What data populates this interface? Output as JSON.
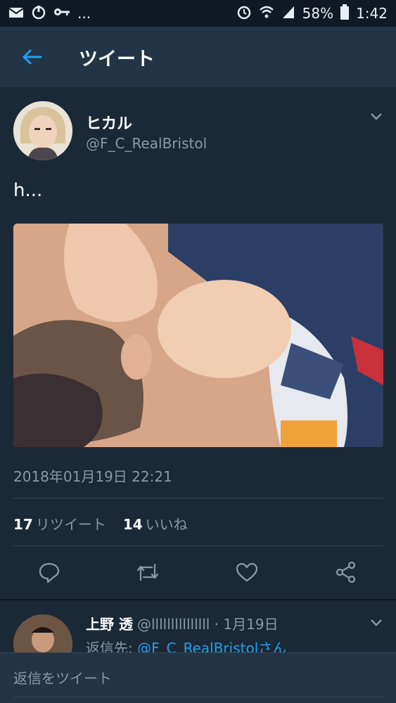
{
  "status_bar": {
    "left_more": "...",
    "battery": "58%",
    "time": "1:42"
  },
  "header": {
    "title": "ツイート"
  },
  "tweet": {
    "name": "ヒカル",
    "handle": "@F_C_RealBristol",
    "text": "h...",
    "timestamp": "2018年01月19日 22:21",
    "retweet_count": "17",
    "retweet_label": "リツイート",
    "like_count": "14",
    "like_label": "いいね"
  },
  "reply": {
    "name": "上野 透",
    "meta": "@lllllllllllllll · 1月19日",
    "reply_to_prefix": "返信先:",
    "reply_to_handle": "@F_C_RealBristolさん"
  },
  "compose": {
    "placeholder": "返信をツイート"
  },
  "colors": {
    "background": "#1b2836",
    "appbar": "#243447",
    "accent": "#1da1f2",
    "muted": "#8899a6"
  }
}
